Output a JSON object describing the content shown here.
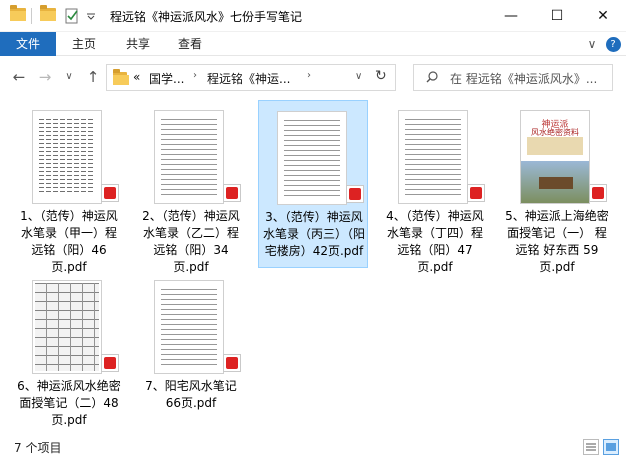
{
  "window": {
    "title": "程远铭《神运派风水》七份手写笔记",
    "minimize_glyph": "—",
    "maximize_glyph": "☐",
    "close_glyph": "✕"
  },
  "ribbon": {
    "tabs": [
      {
        "label": "文件"
      },
      {
        "label": "主页"
      },
      {
        "label": "共享"
      },
      {
        "label": "查看"
      }
    ],
    "collapse_glyph": "∨",
    "help_glyph": "?"
  },
  "nav": {
    "back_glyph": "←",
    "forward_glyph": "→",
    "recent_glyph": "∨",
    "up_glyph": "↑",
    "address_prefix": "«",
    "address_segments": [
      "国学...",
      "程远铭《神运..."
    ],
    "address_dropdown_glyph": "∨",
    "refresh_glyph": "↻",
    "search_placeholder": "在 程远铭《神运派风水》..."
  },
  "files": [
    {
      "name": "1、（范传）神运风水笔录（甲一）程远铭（阳）46页.pdf",
      "thumb": "cols"
    },
    {
      "name": "2、（范传）神运风水笔录（乙二）程远铭（阳）34页.pdf",
      "thumb": "lines"
    },
    {
      "name": "3、（范传）神运风水笔录（丙三）（阳宅楼房）42页.pdf",
      "thumb": "lines"
    },
    {
      "name": "4、（范传）神运风水笔录（丁四）程远铭（阳）47页.pdf",
      "thumb": "lines"
    },
    {
      "name": "5、神运派上海绝密面授笔记（一） 程远铭 好东西 59页.pdf",
      "thumb": "cover"
    },
    {
      "name": "6、神运派风水绝密面授笔记（二）48页.pdf",
      "thumb": "sheet"
    },
    {
      "name": "7、阳宅风水笔记66页.pdf",
      "thumb": "lines"
    }
  ],
  "cover": {
    "title": "神运派",
    "subtitle": "风水绝密资料"
  },
  "status": {
    "item_count": "7 个项目"
  },
  "colors": {
    "accent": "#1f6dbd",
    "selected_bg": "#cce8ff",
    "pdf_red": "#d22"
  }
}
